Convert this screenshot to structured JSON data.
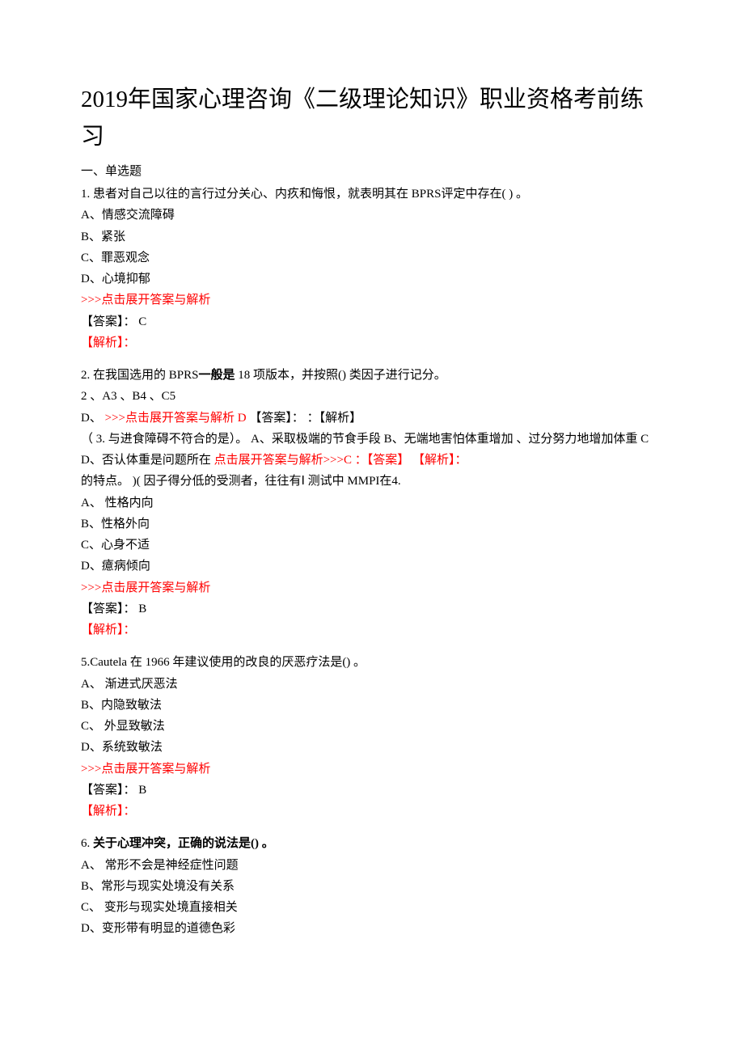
{
  "title": "2019年国家心理咨询《二级理论知识》职业资格考前练习",
  "sectionHead": "一、单选题",
  "q1": {
    "text": "1. 患者对自己以往的言行过分关心、内疚和悔恨，就表明其在 BPRS评定中存在( )  。",
    "a": "A、情感交流障碍",
    "b": "B、紧张",
    "c": "C、罪恶观念",
    "d": "D、心境抑郁",
    "expand": ">>>点击展开答案与解析",
    "ansLabel": "【答案】：  C",
    "explLabel": "【解析】："
  },
  "q2": {
    "pre": "2. 在我国选用的 BPRS",
    "bold": "一般是",
    "post": " 18 项版本，并按照()  类因子进行记分。",
    "line2": "2  、A3  、B4  、C5",
    "dLabel": "D、  ",
    "expand": ">>>点击展开答案与解析 D  ",
    "ans": "【答案】：   ：【解析】"
  },
  "q3": {
    "pre": "（ 3.   与进食障碍不符合的是）。  A、采取极端的节食手段  B、无端地害怕体重增加  、过分努力地增加体重 C D、否认体重是问题所在  ",
    "expand": "点击展开答案与解析>>>C ：【答案】   【解析】："
  },
  "q4": {
    "text": "    的特点。  )(   因子得分低的受测者，往往有Ⅰ 测试中 MMPI在4.",
    "a": "A、  性格内向",
    "b": "B、性格外向",
    "c": "C、心身不适",
    "d": "D、癔病倾向",
    "expand": ">>>点击展开答案与解析",
    "ansLabel": "【答案】：  B",
    "explLabel": "【解析】："
  },
  "q5": {
    "text": "5.Cautela   在 1966 年建议使用的改良的厌恶疗法是()  。",
    "a": "A、  渐进式厌恶法",
    "b": "B、内隐致敏法",
    "c": "C、  外显致敏法",
    "d": "D、系统致敏法",
    "expand": ">>>点击展开答案与解析",
    "ansLabel": "【答案】：  B",
    "explLabel": "【解析】："
  },
  "q6": {
    "num": "6. ",
    "bold": "关于心理冲突，正确的说法是()  。",
    "a": "A、  常形不会是神经症性问题",
    "b": "B、常形与现实处境没有关系",
    "c": "C、  变形与现实处境直接相关",
    "d": "D、变形带有明显的道德色彩"
  }
}
